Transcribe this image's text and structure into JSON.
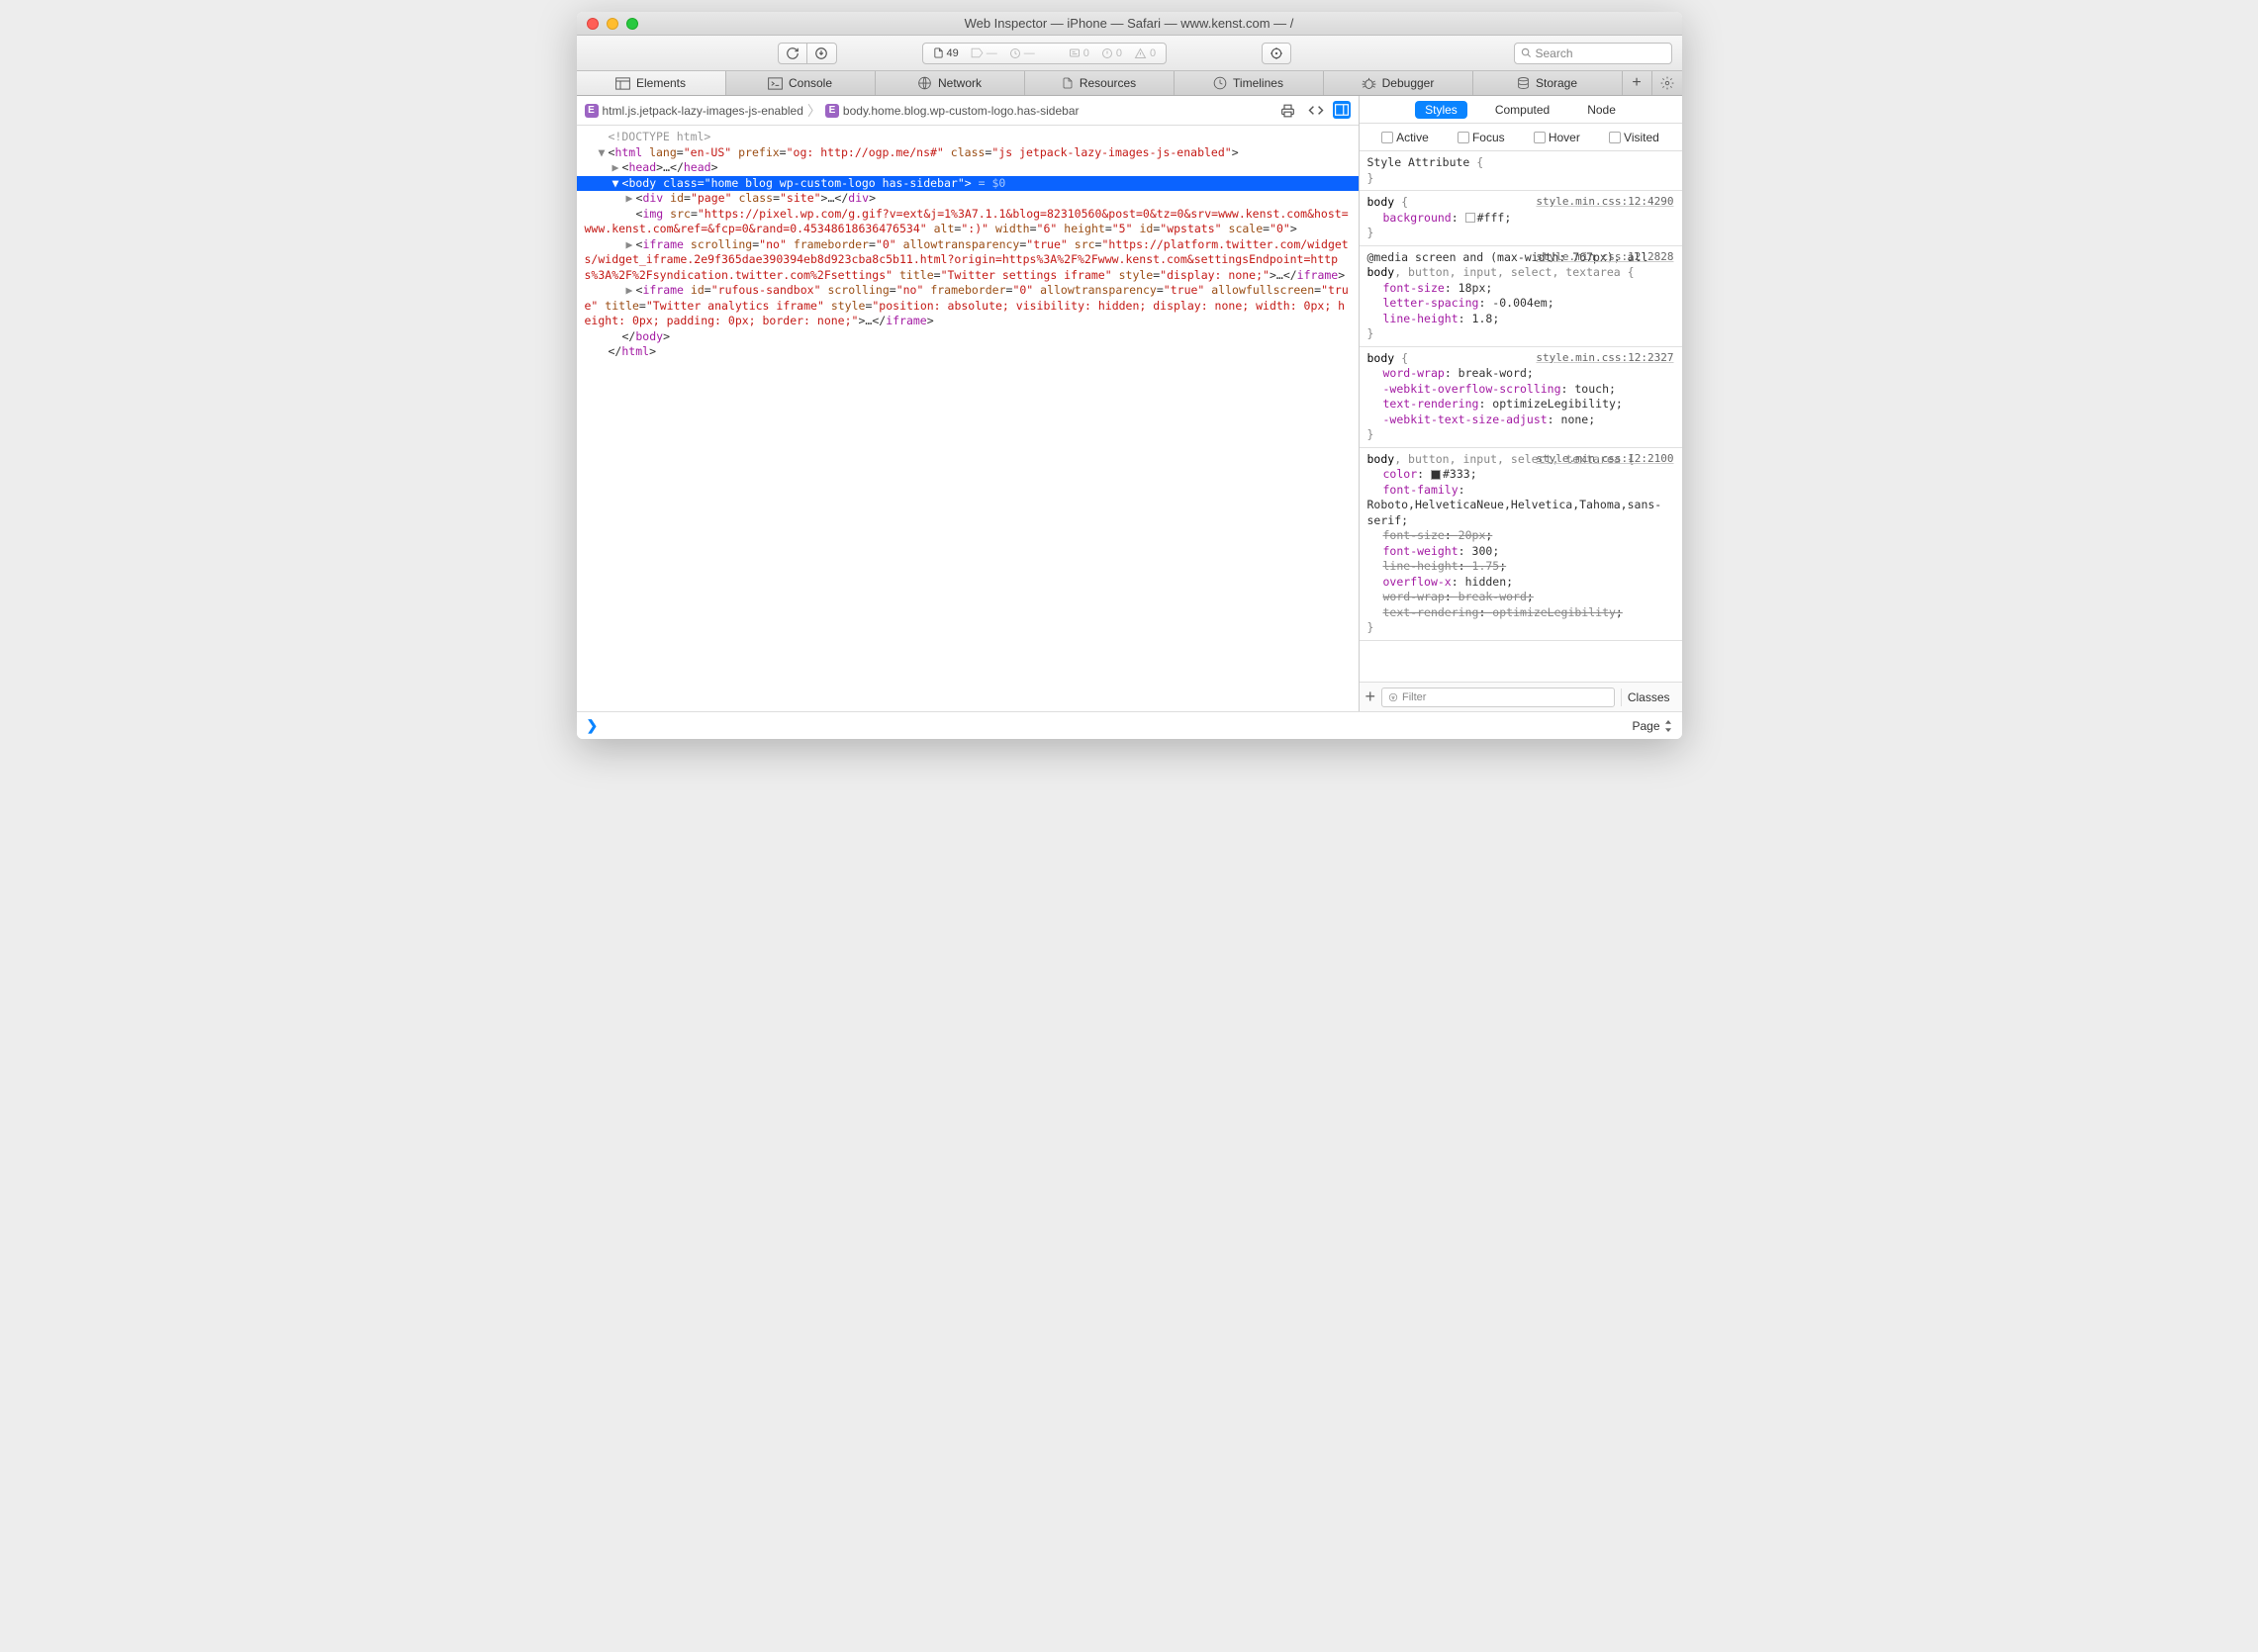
{
  "title": "Web Inspector — iPhone — Safari — www.kenst.com — /",
  "toolbar": {
    "resource_count": "49",
    "msg1": "0",
    "msg2": "0",
    "msg3": "0",
    "search_placeholder": "Search"
  },
  "tabs": {
    "elements": "Elements",
    "console": "Console",
    "network": "Network",
    "resources": "Resources",
    "timelines": "Timelines",
    "debugger": "Debugger",
    "storage": "Storage"
  },
  "breadcrumb": {
    "a": "html.js.jetpack-lazy-images-js-enabled",
    "b": "body.home.blog.wp-custom-logo.has-sidebar"
  },
  "dom": {
    "doctype": "<!DOCTYPE html>",
    "html_open": "<html lang=\"en-US\" prefix=\"og: http://ogp.me/ns#\" class=\"js jetpack-lazy-images-js-enabled\">",
    "head": "<head>…</head>",
    "body_open": "<body class=\"home blog wp-custom-logo has-sidebar\">",
    "body_dollar": " = $0",
    "div_page": "<div id=\"page\" class=\"site\">…</div>",
    "img": "<img src=\"https://pixel.wp.com/g.gif?v=ext&j=1%3A7.1.1&blog=82310560&post=0&tz=0&srv=www.kenst.com&host=www.kenst.com&ref=&fcp=0&rand=0.45348618636476534\" alt=\":)\" width=\"6\" height=\"5\" id=\"wpstats\" scale=\"0\">",
    "iframe1": "<iframe scrolling=\"no\" frameborder=\"0\" allowtransparency=\"true\" src=\"https://platform.twitter.com/widgets/widget_iframe.2e9f365dae390394eb8d923cba8c5b11.html?origin=https%3A%2F%2Fwww.kenst.com&settingsEndpoint=https%3A%2F%2Fsyndication.twitter.com%2Fsettings\" title=\"Twitter settings iframe\" style=\"display: none;\">…</iframe>",
    "iframe2": "<iframe id=\"rufous-sandbox\" scrolling=\"no\" frameborder=\"0\" allowtransparency=\"true\" allowfullscreen=\"true\" title=\"Twitter analytics iframe\" style=\"position: absolute; visibility: hidden; display: none; width: 0px; height: 0px; padding: 0px; border: none;\">…</iframe>",
    "body_close": "</body>",
    "html_close": "</html>"
  },
  "styles_panel": {
    "t_styles": "Styles",
    "t_computed": "Computed",
    "t_node": "Node",
    "p_active": "Active",
    "p_focus": "Focus",
    "p_hover": "Hover",
    "p_visited": "Visited",
    "style_attr": "Style Attribute",
    "filter_placeholder": "Filter",
    "classes": "Classes"
  },
  "rules": [
    {
      "selector_html": "<span class='matched'>body</span> {",
      "origin": "style.min.css:12:4290",
      "props": [
        {
          "n": "background",
          "v": "#fff",
          "swatch": "#fff"
        }
      ]
    },
    {
      "media": "@media screen and (max-width: 767px), all",
      "selector_html": "<span class='matched'>body</span>, button, input, select, textarea {",
      "origin": "style.min.css:12:2828",
      "props": [
        {
          "n": "font-size",
          "v": "18px"
        },
        {
          "n": "letter-spacing",
          "v": "-0.004em"
        },
        {
          "n": "line-height",
          "v": "1.8"
        }
      ]
    },
    {
      "selector_html": "<span class='matched'>body</span> {",
      "origin": "style.min.css:12:2327",
      "props": [
        {
          "n": "word-wrap",
          "v": "break-word"
        },
        {
          "n": "-webkit-overflow-scrolling",
          "v": "touch"
        },
        {
          "n": "text-rendering",
          "v": "optimizeLegibility"
        },
        {
          "n": "-webkit-text-size-adjust",
          "v": "none"
        }
      ]
    },
    {
      "selector_html": "<span class='matched'>body</span>, button, input, select, textarea {",
      "origin": "style.min.css:12:2100",
      "props": [
        {
          "n": "color",
          "v": "#333",
          "swatch": "#333"
        },
        {
          "n": "font-family",
          "v": "Roboto,HelveticaNeue,Helvetica,Tahoma,sans-serif"
        },
        {
          "n": "font-size",
          "v": "20px",
          "strike": true
        },
        {
          "n": "font-weight",
          "v": "300"
        },
        {
          "n": "line-height",
          "v": "1.75",
          "strike": true
        },
        {
          "n": "overflow-x",
          "v": "hidden"
        },
        {
          "n": "word-wrap",
          "v": "break-word",
          "strike": true
        },
        {
          "n": "text-rendering",
          "v": "optimizeLegibility",
          "strike": true
        }
      ]
    }
  ],
  "footer": {
    "page": "Page"
  }
}
